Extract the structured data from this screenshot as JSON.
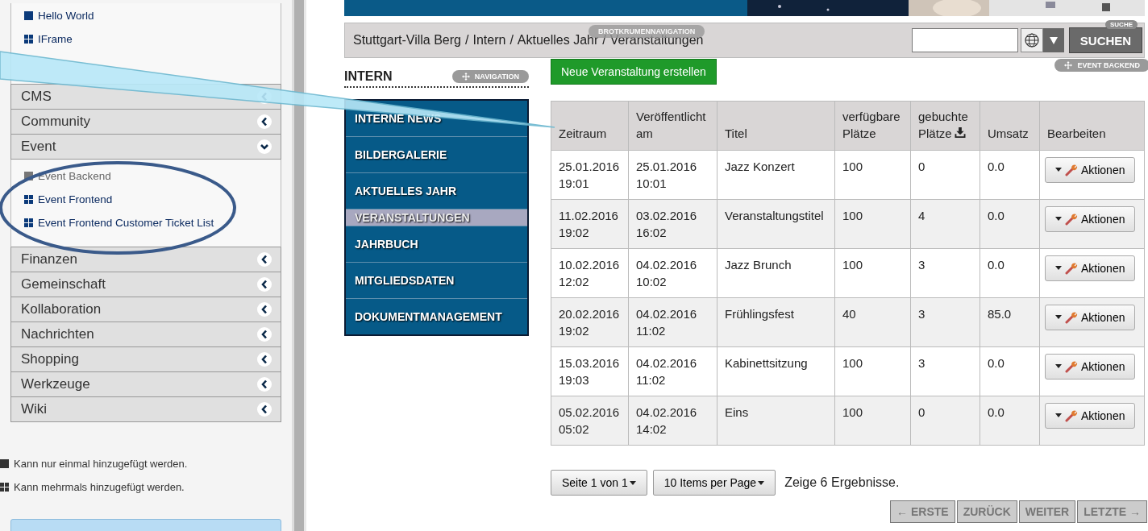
{
  "sidebar": {
    "portlets": [
      {
        "label": "Hello World",
        "kind": "single",
        "disabled": false
      },
      {
        "label": "IFrame",
        "kind": "multiple",
        "disabled": false
      }
    ],
    "categories": [
      {
        "label": "CMS",
        "expanded": false
      },
      {
        "label": "Community",
        "expanded": false
      },
      {
        "label": "Event",
        "expanded": true,
        "children": [
          {
            "label": "Event Backend",
            "kind": "single",
            "disabled": true
          },
          {
            "label": "Event Frontend",
            "kind": "multiple",
            "disabled": false
          },
          {
            "label": "Event Frontend Customer Ticket List",
            "kind": "multiple",
            "disabled": false
          }
        ]
      },
      {
        "label": "Finanzen",
        "expanded": false
      },
      {
        "label": "Gemeinschaft",
        "expanded": false
      },
      {
        "label": "Kollaboration",
        "expanded": false
      },
      {
        "label": "Nachrichten",
        "expanded": false
      },
      {
        "label": "Shopping",
        "expanded": false
      },
      {
        "label": "Werkzeuge",
        "expanded": false
      },
      {
        "label": "Wiki",
        "expanded": false
      }
    ],
    "legend": [
      {
        "kind": "single",
        "text": "Kann nur einmal hinzugefügt werden."
      },
      {
        "kind": "multiple",
        "text": "Kann mehrmals hinzugefügt werden."
      }
    ]
  },
  "breadcrumb": {
    "badge": "BROTKRUMENNAVIGATION",
    "separator": "/",
    "items": [
      "Stuttgart-Villa Berg",
      "Intern",
      "Aktuelles Jahr",
      "Veranstaltungen"
    ]
  },
  "search": {
    "badge": "SUCHE",
    "button": "SUCHEN"
  },
  "navigation": {
    "title": "INTERN",
    "badge": "NAVIGATION",
    "items": [
      {
        "label": "INTERNE NEWS",
        "selected": false
      },
      {
        "label": "BILDERGALERIE",
        "selected": false
      },
      {
        "label": "AKTUELLES JAHR",
        "selected": false
      },
      {
        "label": "VERANSTALTUNGEN",
        "selected": true
      },
      {
        "label": "JAHRBUCH",
        "selected": false
      },
      {
        "label": "MITGLIEDSDATEN",
        "selected": false
      },
      {
        "label": "DOKUMENTMANAGEMENT",
        "selected": false
      }
    ]
  },
  "events": {
    "badge": "EVENT BACKEND",
    "new_button": "Neue Veranstaltung erstellen",
    "columns": [
      [
        "Zeitraum"
      ],
      [
        "Veröffentlicht",
        "am"
      ],
      [
        "Titel"
      ],
      [
        "verfügbare",
        "Plätze"
      ],
      [
        "gebuchte",
        "Plätze"
      ],
      [
        "Umsatz"
      ],
      [
        "Bearbeiten"
      ]
    ],
    "rows": [
      {
        "period": [
          "25.01.2016",
          "19:01"
        ],
        "published": [
          "25.01.2016",
          "10:01"
        ],
        "title": "Jazz Konzert",
        "available": "100",
        "booked": "0",
        "revenue": "0.0",
        "action": "Aktionen"
      },
      {
        "period": [
          "11.02.2016",
          "19:02"
        ],
        "published": [
          "03.02.2016",
          "16:02"
        ],
        "title": "Veranstaltungstitel",
        "available": "100",
        "booked": "4",
        "revenue": "0.0",
        "action": "Aktionen"
      },
      {
        "period": [
          "10.02.2016",
          "12:02"
        ],
        "published": [
          "04.02.2016",
          "10:02"
        ],
        "title": "Jazz Brunch",
        "available": "100",
        "booked": "3",
        "revenue": "0.0",
        "action": "Aktionen"
      },
      {
        "period": [
          "20.02.2016",
          "19:02"
        ],
        "published": [
          "04.02.2016",
          "11:02"
        ],
        "title": "Frühlingsfest",
        "available": "40",
        "booked": "3",
        "revenue": "85.0",
        "action": "Aktionen"
      },
      {
        "period": [
          "15.03.2016",
          "19:03"
        ],
        "published": [
          "04.02.2016",
          "11:02"
        ],
        "title": "Kabinettsitzung",
        "available": "100",
        "booked": "3",
        "revenue": "0.0",
        "action": "Aktionen"
      },
      {
        "period": [
          "05.02.2016",
          "05:02"
        ],
        "published": [
          "04.02.2016",
          "14:02"
        ],
        "title": "Eins",
        "available": "100",
        "booked": "0",
        "revenue": "0.0",
        "action": "Aktionen"
      }
    ]
  },
  "pagination": {
    "page_select": "Seite 1 von 1",
    "per_page": "10 Items per Page",
    "results": "Zeige 6 Ergebnisse.",
    "buttons": [
      {
        "label": "← ERSTE",
        "disabled": true
      },
      {
        "label": "ZURÜCK",
        "disabled": true
      },
      {
        "label": "WEITER",
        "disabled": true
      },
      {
        "label": "LETZTE →",
        "disabled": true
      }
    ]
  }
}
